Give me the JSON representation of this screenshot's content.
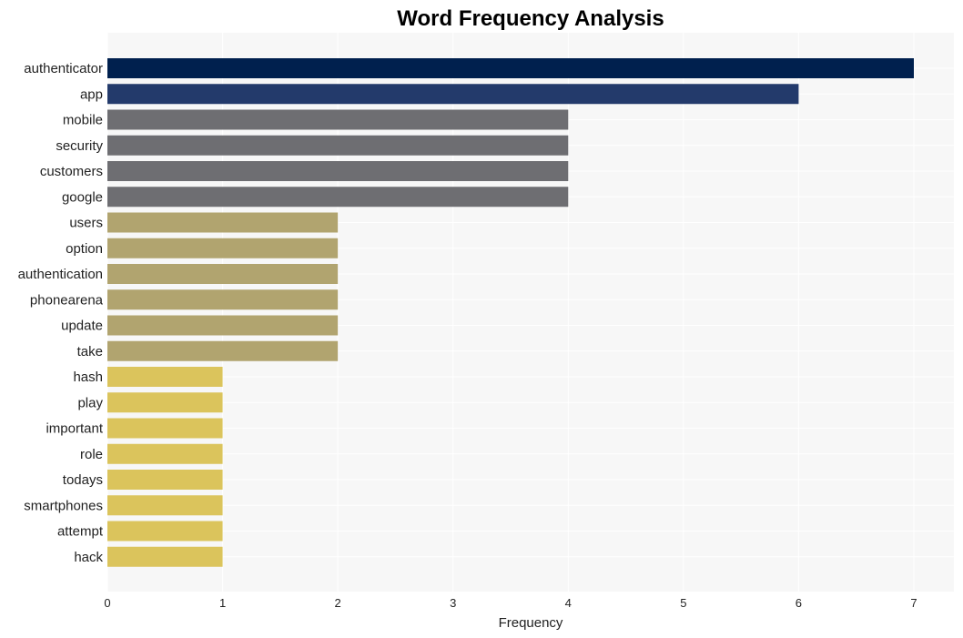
{
  "chart_data": {
    "type": "bar",
    "orientation": "horizontal",
    "title": "Word Frequency Analysis",
    "xlabel": "Frequency",
    "ylabel": "",
    "xlim": [
      0,
      7.35
    ],
    "xticks": [
      0,
      1,
      2,
      3,
      4,
      5,
      6,
      7
    ],
    "grid": true,
    "categories": [
      "authenticator",
      "app",
      "mobile",
      "security",
      "customers",
      "google",
      "users",
      "option",
      "authentication",
      "phonearena",
      "update",
      "take",
      "hash",
      "play",
      "important",
      "role",
      "todays",
      "smartphones",
      "attempt",
      "hack"
    ],
    "values": [
      7,
      6,
      4,
      4,
      4,
      4,
      2,
      2,
      2,
      2,
      2,
      2,
      1,
      1,
      1,
      1,
      1,
      1,
      1,
      1
    ],
    "bar_colors": [
      "#00204e",
      "#233a6b",
      "#6e6e72",
      "#6e6e72",
      "#6e6e72",
      "#6e6e72",
      "#b1a46f",
      "#b1a46f",
      "#b1a46f",
      "#b1a46f",
      "#b1a46f",
      "#b1a46f",
      "#dbc45c",
      "#dbc45c",
      "#dbc45c",
      "#dbc45c",
      "#dbc45c",
      "#dbc45c",
      "#dbc45c",
      "#dbc45c"
    ],
    "background": "#f7f7f7"
  }
}
